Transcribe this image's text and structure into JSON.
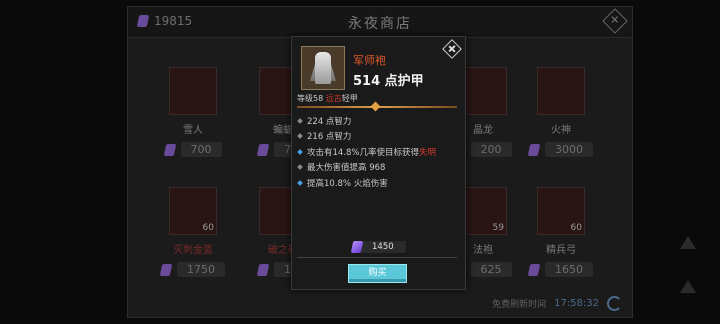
{
  "shop": {
    "currency": "19815",
    "title": "永夜商店",
    "close": "✕",
    "refresh_label": "免费刷新时间",
    "refresh_time": "17:58:32",
    "items": [
      {
        "name": "雪人",
        "price": "700",
        "qty": "",
        "red": false
      },
      {
        "name": "蝙蝠",
        "price": "70",
        "qty": "",
        "red": false
      },
      {
        "name": "",
        "price": "",
        "qty": "",
        "red": false
      },
      {
        "name": "晶龙",
        "price": "200",
        "qty": "",
        "red": false
      },
      {
        "name": "火神",
        "price": "3000",
        "qty": "",
        "red": false
      },
      {
        "name": "灭刺金盔",
        "price": "1750",
        "qty": "60",
        "red": true
      },
      {
        "name": "破之靴",
        "price": "13",
        "qty": "",
        "red": false
      },
      {
        "name": "",
        "price": "",
        "qty": "",
        "red": false
      },
      {
        "name": "法袍",
        "price": "625",
        "qty": "59",
        "red": false
      },
      {
        "name": "精兵弓",
        "price": "1650",
        "qty": "60",
        "red": false
      }
    ]
  },
  "popup": {
    "item_name": "军师袍",
    "main_stat": "514 点护甲",
    "level_prefix": "等级58 ",
    "level_quality": "远古",
    "level_suffix": "轻甲",
    "attributes": [
      {
        "text": "224 点智力",
        "highlight": "",
        "bullet": "gray"
      },
      {
        "text": "216 点智力",
        "highlight": "",
        "bullet": "gray"
      },
      {
        "text": "攻击有14.8%几率使目标获得",
        "highlight": "失明",
        "bullet": "blue"
      },
      {
        "text": "最大伤害值提高 968",
        "highlight": "",
        "bullet": "gray"
      },
      {
        "text": "提高10.8% 火焰伤害",
        "highlight": "",
        "bullet": "blue"
      }
    ],
    "price": "1450",
    "buy_label": "购买"
  },
  "colors": {
    "item_name": "#e05a2a",
    "quality": "#d23a2a",
    "buy_button": "#5ac8d8",
    "gem": "#8a5ae0"
  }
}
